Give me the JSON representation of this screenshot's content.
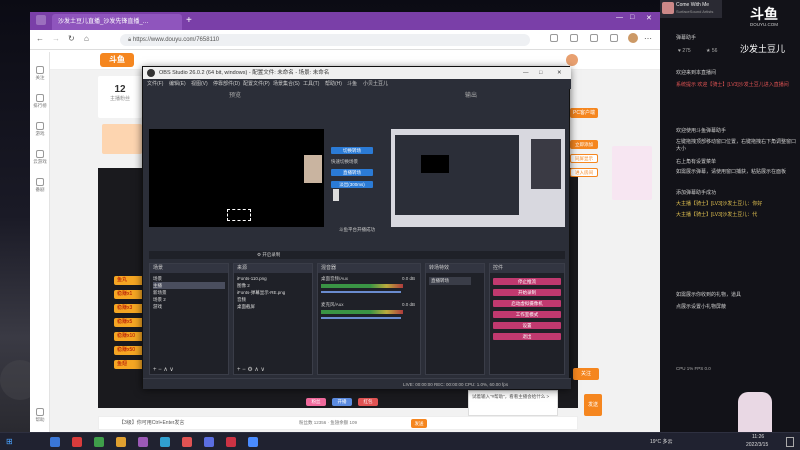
{
  "browser": {
    "tab_title": "沙发土豆儿直播_沙发先锋直播_…",
    "url": "https://www.douyu.com/7658110"
  },
  "douyu": {
    "follow_count": "12",
    "follow_label": "主播粉丝",
    "nav": [
      "关注",
      "排行榜",
      "游戏",
      "云游戏",
      "番剧",
      "帮助"
    ],
    "follow_button": "关注",
    "pc_badge": "PC客户端",
    "right_side_buttons": [
      "立即添加",
      "同屏显示",
      "进入房间"
    ],
    "chat_input_placeholder": "【3级】你可用Ctrl+Enter发言",
    "gift_ticker": [
      "鱼丸",
      "稳赚x1",
      "稳赚x3",
      "稳赚x5",
      "稳赚x10",
      "稳赚x50",
      "鱼翅"
    ],
    "bottom_stats": "粉丝数 12356 · 鱼翅余额 109",
    "bottom_banner": "试着输入\"#帮助\"，看看主播会给什么 >",
    "send_button": "发送",
    "bottom_icon_labels": [
      "粉丝",
      "开播",
      "红包"
    ]
  },
  "obs": {
    "title": "OBS Studio 26.0.2 (64 bit, windows) - 配置文件: 未命名 - 场景: 未命名",
    "menu": [
      "文件(F)",
      "编辑(E)",
      "视图(V)",
      "停靠部件(D)",
      "配置文件(P)",
      "场景集合(S)",
      "工具(T)",
      "帮助(H)",
      "斗鱼",
      "小贝土豆儿"
    ],
    "preview_label": "预览",
    "program_label": "输出",
    "transition_buttons": [
      "切换转场",
      "快速切换场景",
      "直播转场",
      "淡出(300ms)"
    ],
    "start_text": "斗鱼平台开播成功",
    "rec_label": "开启录制",
    "scenes_dock": "场景",
    "scenes": [
      "场景",
      "主播",
      "新场景",
      "场景 2",
      "游戏"
    ],
    "sources_dock": "来源",
    "sources": [
      "iFonts-110.png",
      "图像 2",
      "iFonts-弹幕显示-RE.png",
      "音频",
      "桌面截屏"
    ],
    "mixer_dock": "混音器",
    "mixer_tracks": [
      {
        "name": "桌面音频/Aux",
        "db": "0.0 dB"
      },
      {
        "name": "麦克风/Aux",
        "db": "0.0 dB"
      }
    ],
    "transitions_dock": "转场特效",
    "transition_selected": "直播转场",
    "controls_dock": "控件",
    "controls": [
      "停止推流",
      "开始录制",
      "启动虚拟摄像机",
      "工作室模式",
      "设置",
      "退出"
    ],
    "status": "LIVE: 00:00:00   REC: 00:00:00   CPU: 1.0%, 60.00 fps"
  },
  "stream_pane": {
    "logo": "斗鱼",
    "logo_sub": "DOUYU.COM",
    "streamer": "沙发土豆儿",
    "notify_title": "Come With Me",
    "notify_sub": "SurfaceSound Artists",
    "header_left": "弹幕助手",
    "header_stats": [
      "275",
      "56"
    ],
    "chat": [
      {
        "text": "欢迎来到本直播间",
        "cls": ""
      },
      {
        "text": "系统提示 欢迎【骑士】[LV3]沙发土豆儿进入直播间",
        "cls": "gift-red"
      },
      {
        "text": "欢迎使用斗鱼弹幕助手",
        "cls": ""
      },
      {
        "text": "左键拖拽顶部移动窗口位置，右键拖拽右下角调整窗口大小",
        "cls": ""
      },
      {
        "text": "右上角有设置菜单",
        "cls": ""
      },
      {
        "text": "如需展示弹幕，请使用窗口捕获，粘贴展示在面板",
        "cls": ""
      },
      {
        "text": "添加弹幕助手成功",
        "cls": ""
      },
      {
        "text": "大主播【骑士】[LV3]沙发土豆儿：你好",
        "cls": "gift-yel"
      },
      {
        "text": "大主播【骑士】[LV3]沙发土豆儿：代",
        "cls": "gift-yel"
      },
      {
        "text": "如需展示你收到的礼物，道具",
        "cls": ""
      },
      {
        "text": "点展示设置小礼物屏蔽",
        "cls": ""
      }
    ],
    "bottom_meter": "CPU 1%   FPS 0.0"
  },
  "taskbar": {
    "weather": "19°C 多云",
    "time": "11:26",
    "date": "2022/3/15",
    "colors": [
      "#3a76d6",
      "#d93c3c",
      "#3f9e4a",
      "#e0a030",
      "#9b59b6",
      "#30a0d0",
      "#e05353",
      "#5b6ee0",
      "#cc3344",
      "#4a8cff"
    ]
  }
}
